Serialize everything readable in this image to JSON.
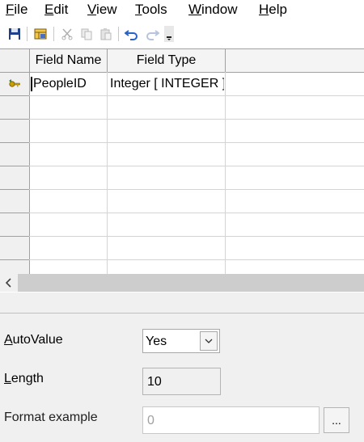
{
  "menubar": {
    "items": [
      {
        "label": "File",
        "accel": "F",
        "rest": "ile"
      },
      {
        "label": "Edit",
        "accel": "E",
        "rest": "dit"
      },
      {
        "label": "View",
        "accel": "V",
        "rest": "iew"
      },
      {
        "label": "Tools",
        "accel": "T",
        "rest": "ools"
      },
      {
        "label": "Window",
        "accel": "W",
        "rest": "indow"
      },
      {
        "label": "Help",
        "accel": "H",
        "rest": "elp"
      }
    ]
  },
  "toolbar": {
    "icons": [
      "save-icon",
      "table-properties-icon",
      "cut-icon",
      "copy-icon",
      "paste-icon",
      "undo-icon",
      "redo-icon",
      "more-options-icon"
    ]
  },
  "grid": {
    "columns": [
      "Field Name",
      "Field Type"
    ],
    "rows": [
      {
        "field_name": "PeopleID",
        "field_type": "Integer [ INTEGER ]",
        "primary_key": true
      }
    ]
  },
  "properties": {
    "autovalue": {
      "label_accel": "A",
      "label_rest": "utoValue",
      "value": "Yes"
    },
    "length": {
      "label_accel": "L",
      "label_rest": "ength",
      "value": "10"
    },
    "format_example": {
      "label": "Format example",
      "value": "0",
      "button_label": "..."
    }
  },
  "colors": {
    "grid_line": "#d4d4d4",
    "panel_bg": "#f0f0f0",
    "key_icon": "#c8a000"
  }
}
